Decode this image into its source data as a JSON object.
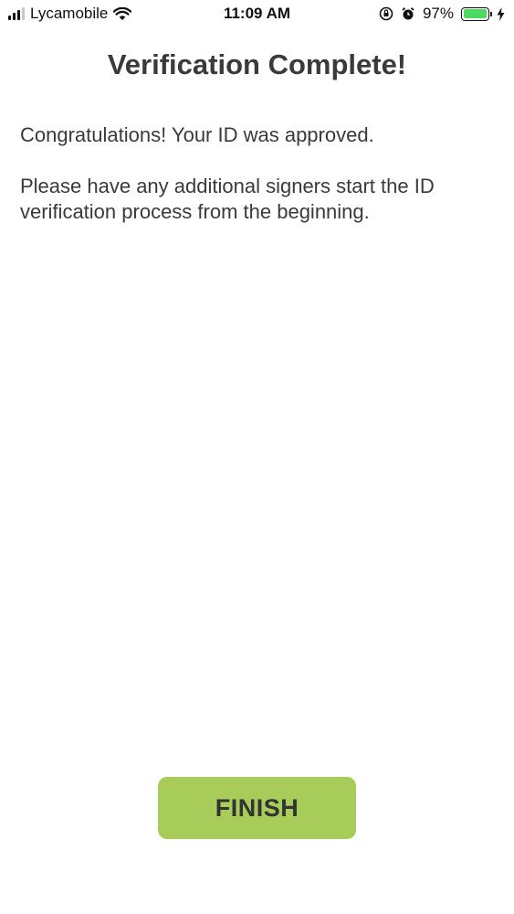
{
  "status_bar": {
    "carrier": "Lycamobile",
    "time": "11:09 AM",
    "battery_percent": "97%",
    "battery_level": 0.97,
    "icons": [
      "signal-icon",
      "wifi-icon",
      "orientation-lock-icon",
      "alarm-icon",
      "battery-icon",
      "charging-bolt-icon"
    ]
  },
  "page": {
    "title": "Verification Complete!",
    "message_approved": "Congratulations! Your ID was approved.",
    "message_signers": "Please have any additional signers start the ID verification process from the beginning."
  },
  "actions": {
    "finish_label": "FINISH"
  },
  "colors": {
    "button_bg": "#a8cc5a",
    "text": "#3a3a3a",
    "battery_fill": "#4cd964"
  }
}
